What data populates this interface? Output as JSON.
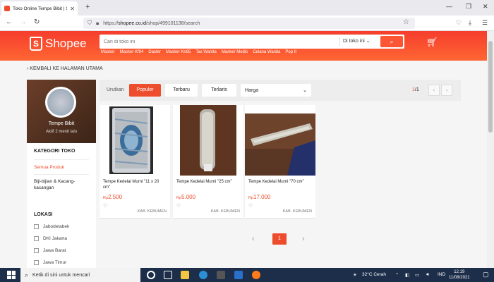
{
  "browser": {
    "tab_title": "Toko Online Tempe Bibit | Shop",
    "url_prefix": "https://",
    "url_host": "shopee.co.id",
    "url_path": "/shop/499101138/search"
  },
  "header": {
    "brand": "Shopee",
    "search_placeholder": "Cari di toko ini",
    "search_scope": "Di toko ini",
    "keywords": [
      "Masker",
      "Masker Kf94",
      "Daster",
      "Masker Kn95",
      "Tas Wanita",
      "Masker Medis",
      "Celana Wanita",
      "Pop It"
    ]
  },
  "page": {
    "back_link": "KEMBALI KE HALAMAN UTAMA"
  },
  "shop": {
    "name": "Tempe Bibit",
    "active": "Aktif 2 menit lalu"
  },
  "categories": {
    "heading": "KATEGORI TOKO",
    "active": "Semua Produk",
    "item": "Biji-bijian & Kacang-kacangan"
  },
  "locations": {
    "heading": "LOKASI",
    "items": [
      "Jabodetabek",
      "DKI Jakarta",
      "Jawa Barat",
      "Jawa Timur"
    ]
  },
  "sort": {
    "label": "Urutkan",
    "popular": "Populer",
    "newest": "Terbaru",
    "best_selling": "Terlaris",
    "price": "Harga",
    "page_current": "1",
    "page_total": "/1"
  },
  "products": [
    {
      "name": "Tempe Kedelai Murni \"11 x 20 cm\"",
      "currency": "Rp",
      "price": "2.500",
      "location": "KAB. KEBUMEN"
    },
    {
      "name": "Tempe Kedelai Murni \"25 cm\"",
      "currency": "Rp",
      "price": "5.000",
      "location": "KAB. KEBUMEN"
    },
    {
      "name": "Tempe Kedelai Murni \"70 cm\"",
      "currency": "Rp",
      "price": "17.000",
      "location": "KAB. KEBUMEN"
    }
  ],
  "pagination": {
    "current": "1"
  },
  "taskbar": {
    "search": "Ketik di sini untuk mencari",
    "weather": "32°C  Cerah",
    "lang": "IND",
    "time": "12.19",
    "date": "11/08/2021"
  },
  "colors": {
    "brand": "#ee4d2d",
    "taskbar": "#1d2e4a"
  }
}
